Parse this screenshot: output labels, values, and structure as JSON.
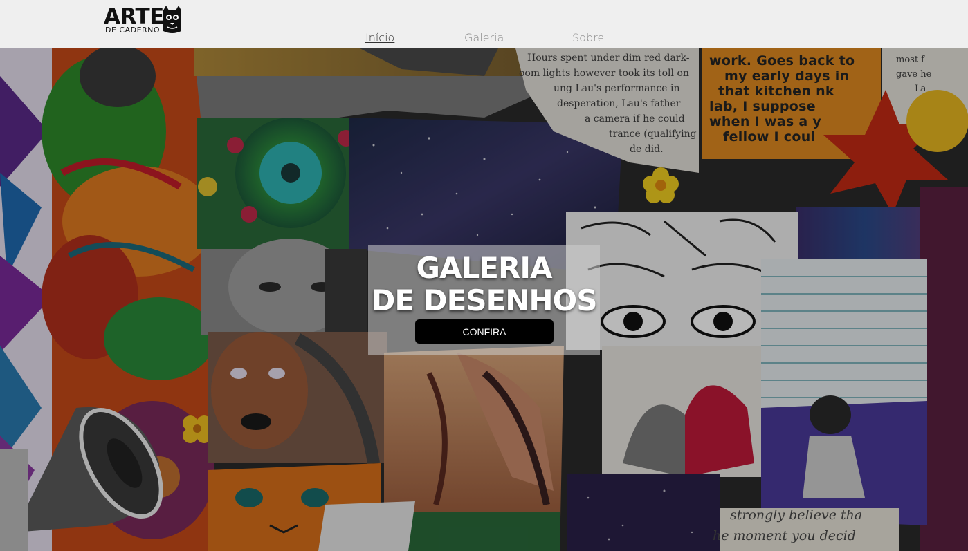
{
  "logo": {
    "main": "ARTE",
    "sub": "DE CADERNO"
  },
  "nav": {
    "items": [
      {
        "label": "Início",
        "active": true
      },
      {
        "label": "Galeria",
        "active": false
      },
      {
        "label": "Sobre",
        "active": false
      }
    ]
  },
  "hero": {
    "title_line1": "GALERIA",
    "title_line2": "DE DESENHOS",
    "cta_label": "CONFIRA"
  },
  "collage_text": {
    "article_lines": [
      "Hours spent under dim red dark-",
      "oom lights however took its toll on",
      "ung Lau's performance in",
      "desperation, Lau's father",
      "a camera if he could",
      "trance (qualifying",
      "de did."
    ],
    "bold_lines": [
      "work. Goes back to",
      "my early days in",
      "that kitchen  nk",
      "lab, I suppose",
      "when I was a y",
      "fellow I coul"
    ],
    "side_lines": [
      "most f",
      "gave he",
      "La"
    ],
    "script_lines": [
      "strongly believe tha",
      "he moment you decid"
    ]
  },
  "colors": {
    "header_bg": "#efefef",
    "cta_bg": "#000000",
    "cta_text": "#ffffff",
    "title_text": "#ffffff"
  }
}
